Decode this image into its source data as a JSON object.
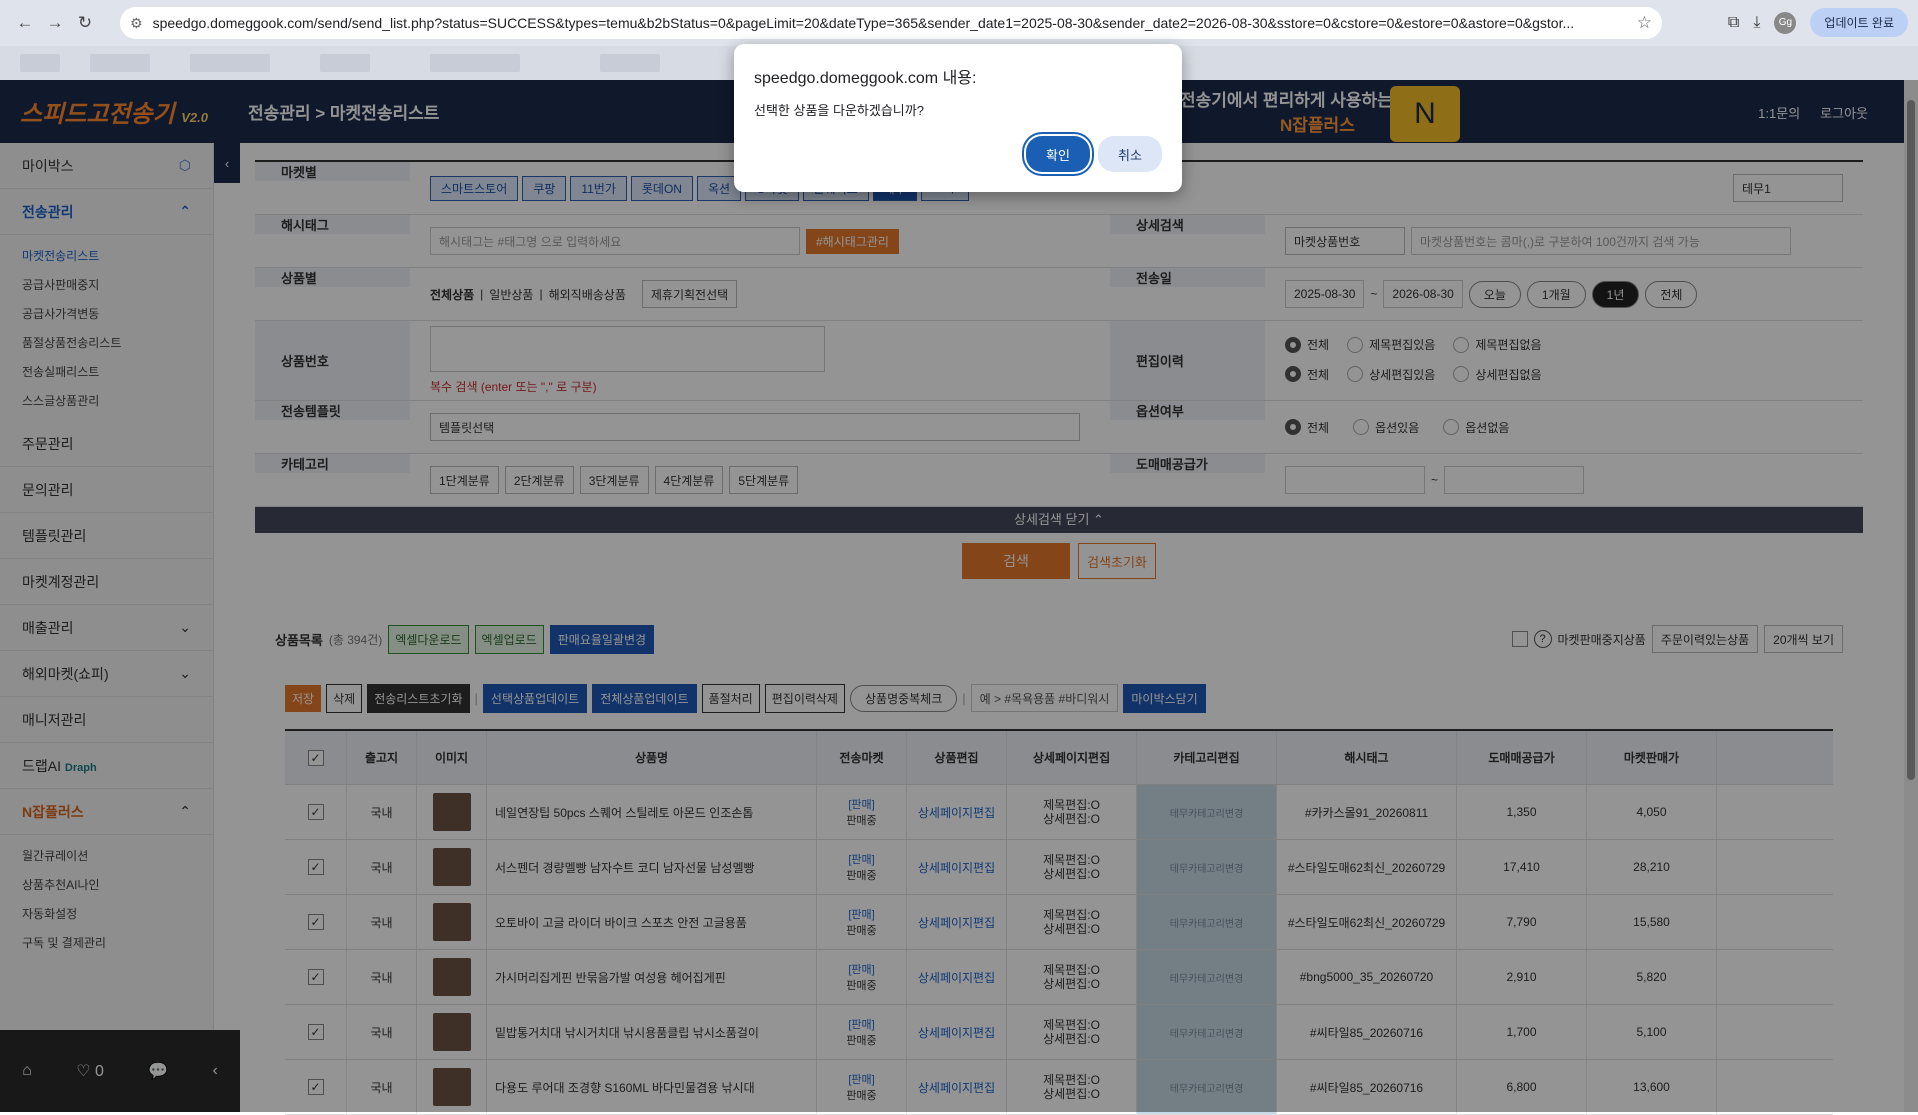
{
  "browser": {
    "url": "speedgo.domeggook.com/send/send_list.php?status=SUCCESS&types=temu&b2bStatus=0&pageLimit=20&dateType=365&sender_date1=2025-08-30&sender_date2=2026-08-30&sstore=0&cstore=0&estore=0&astore=0&gstor...",
    "update_label": "업데이트 완료",
    "profile": "Gg"
  },
  "header": {
    "logo": "스피드고전송기",
    "logo_ver": "V2.0",
    "breadcrumb": "전송관리 > 마켓전송리스트",
    "promo": "전송기에서 편리하게 사용하는",
    "promo2": "N잡플러스",
    "inquiry": "1:1문의",
    "logout": "로그아웃"
  },
  "sidebar": {
    "mybox": "마이박스",
    "transfer": "전송관리",
    "sub": [
      "마켓전송리스트",
      "공급사판매중지",
      "공급사가격변동",
      "품절상품전송리스트",
      "전송실패리스트",
      "스스글상품관리"
    ],
    "items": [
      "주문관리",
      "문의관리",
      "템플릿관리",
      "마켓계정관리"
    ],
    "sales": "매출관리",
    "overseas": "해외마켓(쇼피)",
    "manager": "매니저관리",
    "drap": "드랩AI",
    "drap_brand": "Draph",
    "njob": "N잡플러스",
    "njob_sub": [
      "월간큐레이션",
      "상품추천AI나인",
      "자동화설정",
      "구독 및 결제관리"
    ],
    "widget_count": "0"
  },
  "form": {
    "market_label": "마켓별",
    "markets": [
      "스마트스토어",
      "쿠팡",
      "11번가",
      "롯데ON",
      "옥션",
      "G마켓",
      "올웨이즈",
      "테무",
      "Gmp"
    ],
    "market_select": "테무1",
    "hashtag_label": "해시태그",
    "hashtag_placeholder": "해시태그는 #태그명 으로 입력하세요",
    "hashtag_btn": "#해시태그관리",
    "detail_search_label": "상세검색",
    "detail_search_select": "마켓상품번호",
    "detail_search_placeholder": "마켓상품번호는 콤마(,)로 구분하여 100건까지 검색 가능",
    "product_label": "상품별",
    "product_types": [
      "전체상품",
      "일반상품",
      "해외직배송상품"
    ],
    "product_select": "제휴기획전선택",
    "send_date_label": "전송일",
    "date_from": "2025-08-30",
    "date_to": "2026-08-30",
    "date_pills": [
      "오늘",
      "1개월",
      "1년",
      "전체"
    ],
    "product_no_label": "상품번호",
    "product_no_hint": "복수 검색 (enter 또는 \",\" 로 구분)",
    "edit_history_label": "편집이력",
    "edit_row1": [
      "전체",
      "제목편집있음",
      "제목편집없음"
    ],
    "edit_row2": [
      "전체",
      "상세편집있음",
      "상세편집없음"
    ],
    "template_label": "전송템플릿",
    "template_select": "템플릿선택",
    "option_label": "옵션여부",
    "options": [
      "전체",
      "옵션있음",
      "옵션없음"
    ],
    "category_label": "카테고리",
    "categories": [
      "1단계분류",
      "2단계분류",
      "3단계분류",
      "4단계분류",
      "5단계분류"
    ],
    "wholesale_label": "도매매공급가",
    "detail_toggle": "상세검색 닫기 ⌃",
    "search_btn": "검색",
    "reset_btn": "검색초기화"
  },
  "list": {
    "title": "상품목록",
    "count": "(총 394건)",
    "excel_down": "엑셀다운로드",
    "excel_up": "엑셀업로드",
    "rate_btn": "판매요율일괄변경",
    "stopped": "마켓판매중지상품",
    "order_filter": "주문이력있는상품",
    "page_size": "20개씩 보기",
    "tools": [
      "저장",
      "삭제",
      "전송리스트초기화",
      "선택상품업데이트",
      "전체상품업데이트",
      "품절처리",
      "편집이력삭제",
      "상품명중복체크"
    ],
    "hashtag_example": "예 > #목욕용품 #바디워시",
    "mybox_btn": "마이박스담기"
  },
  "table": {
    "headers": [
      "출고지",
      "이미지",
      "상품명",
      "전송마켓",
      "상품편집",
      "상세페이지편집",
      "카테고리편집",
      "해시태그",
      "도매매공급가",
      "마켓판매가"
    ],
    "rows": [
      {
        "origin": "국내",
        "name": "네일연장팁 50pcs 스퀘어 스틸레토 아몬드 인조손톱",
        "status": "[판매]",
        "state2": "판매중",
        "edit": "상세페이지편집",
        "title_edit": "제목편집:O",
        "detail_edit": "상세편집:O",
        "cat": "테무카테고리변경",
        "tag": "#카카스몰91_20260811",
        "supply": "1,350",
        "sale": "4,050"
      },
      {
        "origin": "국내",
        "name": "서스펜더 경량멜빵 남자수트 코디 남자선물 남성멜빵",
        "status": "[판매]",
        "state2": "판매중",
        "edit": "상세페이지편집",
        "title_edit": "제목편집:O",
        "detail_edit": "상세편집:O",
        "cat": "테무카테고리변경",
        "tag": "#스타일도매62최신_20260729",
        "supply": "17,410",
        "sale": "28,210"
      },
      {
        "origin": "국내",
        "name": "오토바이 고글 라이더 바이크 스포츠 안전 고글용품",
        "status": "[판매]",
        "state2": "판매중",
        "edit": "상세페이지편집",
        "title_edit": "제목편집:O",
        "detail_edit": "상세편집:O",
        "cat": "테무카테고리변경",
        "tag": "#스타일도매62최신_20260729",
        "supply": "7,790",
        "sale": "15,580"
      },
      {
        "origin": "국내",
        "name": "가시머리집게핀 반묶음가발 여성용 헤어집게핀",
        "status": "[판매]",
        "state2": "판매중",
        "edit": "상세페이지편집",
        "title_edit": "제목편집:O",
        "detail_edit": "상세편집:O",
        "cat": "테무카테고리변경",
        "tag": "#bng5000_35_20260720",
        "supply": "2,910",
        "sale": "5,820"
      },
      {
        "origin": "국내",
        "name": "밑밥통거치대 낚시거치대 낚시용품클립 낚시소품걸이",
        "status": "[판매]",
        "state2": "판매중",
        "edit": "상세페이지편집",
        "title_edit": "제목편집:O",
        "detail_edit": "상세편집:O",
        "cat": "테무카테고리변경",
        "tag": "#씨타일85_20260716",
        "supply": "1,700",
        "sale": "5,100"
      },
      {
        "origin": "국내",
        "name": "다용도 루어대 조경향 S160ML 바다민물겸용 낚시대",
        "status": "[판매]",
        "state2": "판매중",
        "edit": "상세페이지편집",
        "title_edit": "제목편집:O",
        "detail_edit": "상세편집:O",
        "cat": "테무카테고리변경",
        "tag": "#씨타일85_20260716",
        "supply": "6,800",
        "sale": "13,600"
      }
    ]
  },
  "dialog": {
    "title": "speedgo.domeggook.com 내용:",
    "message": "선택한 상품을 다운하겠습니까?",
    "ok": "확인",
    "cancel": "취소"
  }
}
